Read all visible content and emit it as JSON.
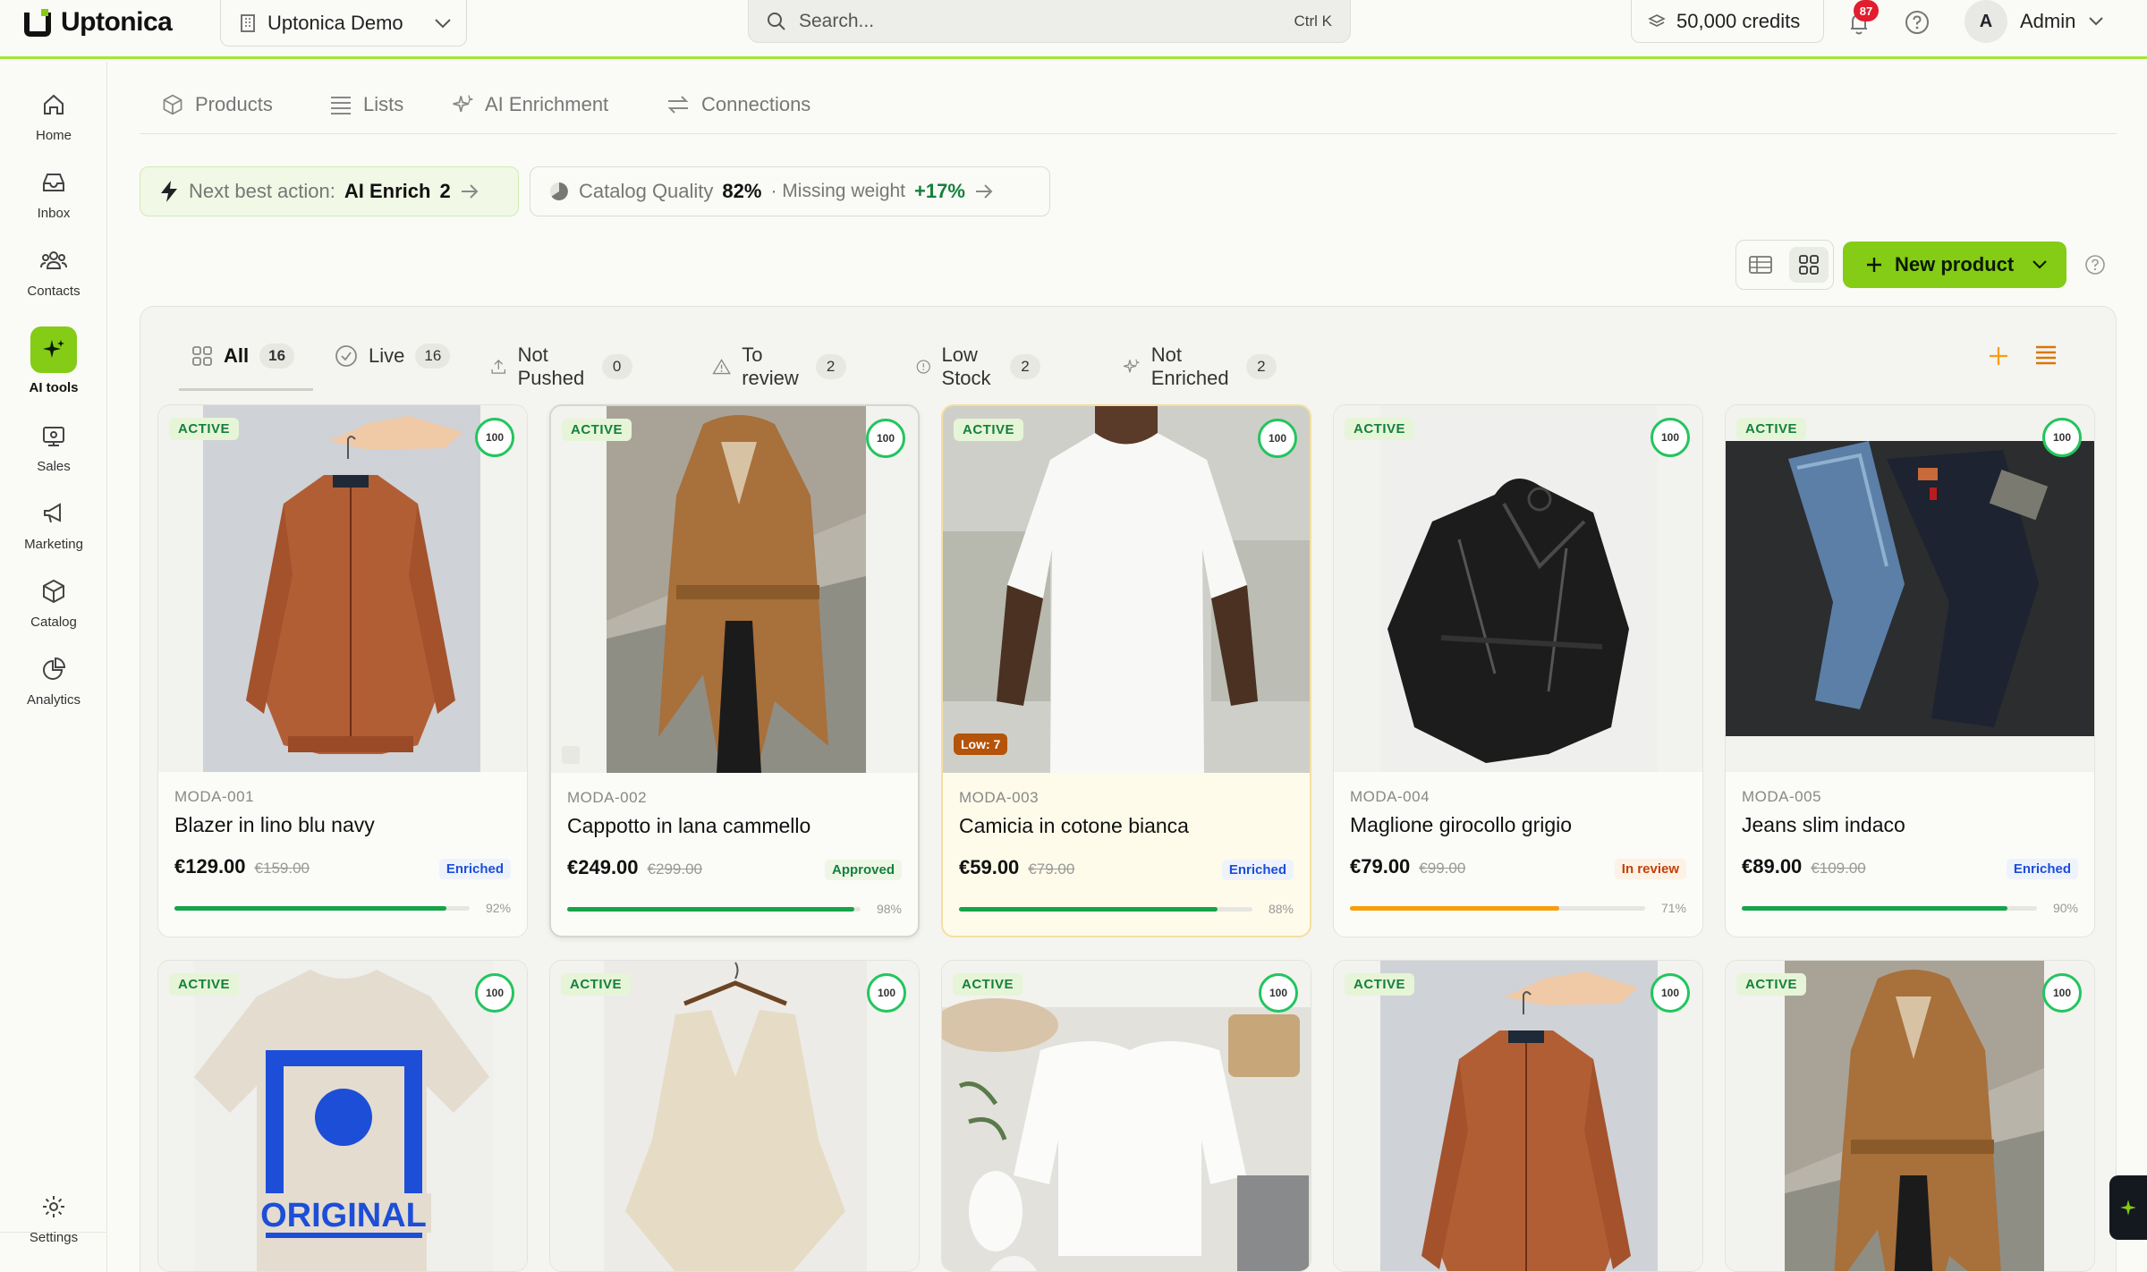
{
  "app": {
    "name": "Uptonica",
    "workspace": "Uptonica Demo",
    "search_placeholder": "Search...",
    "search_shortcut": "Ctrl K",
    "credits": "50,000 credits",
    "notifications_count": "87",
    "user_initial": "A",
    "user_name": "Admin",
    "accent_color": "#84cc16"
  },
  "sidebar": {
    "items": [
      {
        "label": "Home",
        "icon": "home-icon"
      },
      {
        "label": "Inbox",
        "icon": "inbox-icon"
      },
      {
        "label": "Contacts",
        "icon": "contacts-icon"
      },
      {
        "label": "AI tools",
        "icon": "sparkle-icon",
        "active": true
      },
      {
        "label": "Sales",
        "icon": "sales-icon"
      },
      {
        "label": "Marketing",
        "icon": "megaphone-icon"
      },
      {
        "label": "Catalog",
        "icon": "box-icon"
      },
      {
        "label": "Analytics",
        "icon": "pie-chart-icon"
      }
    ],
    "settings_label": "Settings"
  },
  "subnav": {
    "items": [
      "Products",
      "Lists",
      "AI Enrichment",
      "Connections"
    ]
  },
  "insights": {
    "next_best_action_label": "Next best action:",
    "next_best_action_value": "AI Enrich",
    "next_best_action_count": "2",
    "catalog_quality_label": "Catalog Quality",
    "catalog_quality_value": "82%",
    "missing_label": "· Missing weight",
    "missing_delta": "+17%"
  },
  "toolbar": {
    "new_product_label": "New product"
  },
  "tabs": [
    {
      "label": "All",
      "count": "16",
      "icon": "grid-icon"
    },
    {
      "label": "Live",
      "count": "16",
      "icon": "check-circle-icon"
    },
    {
      "label": "Not Pushed",
      "count": "0",
      "icon": "upload-icon"
    },
    {
      "label": "To review",
      "count": "2",
      "icon": "warning-icon"
    },
    {
      "label": "Low Stock",
      "count": "2",
      "icon": "alert-circle-icon"
    },
    {
      "label": "Not Enriched",
      "count": "2",
      "icon": "sparkle-icon"
    }
  ],
  "products": [
    {
      "badge": "ACTIVE",
      "score": "100",
      "sku": "MODA-001",
      "name": "Blazer in lino blu navy",
      "price": "€129.00",
      "old_price": "€159.00",
      "status": "Enriched",
      "status_kind": "enriched",
      "completeness": "92%",
      "completeness_value": 0.92,
      "bar_color": "#16a34a",
      "image": "bomber-jacket"
    },
    {
      "badge": "ACTIVE",
      "score": "100",
      "sku": "MODA-002",
      "name": "Cappotto in lana cammello",
      "price": "€249.00",
      "old_price": "€299.00",
      "status": "Approved",
      "status_kind": "approved",
      "completeness": "98%",
      "completeness_value": 0.98,
      "bar_color": "#16a34a",
      "image": "camel-coat"
    },
    {
      "badge": "ACTIVE",
      "score": "100",
      "sku": "MODA-003",
      "name": "Camicia in cotone bianca",
      "price": "€59.00",
      "old_price": "€79.00",
      "status": "Enriched",
      "status_kind": "enriched",
      "completeness": "88%",
      "completeness_value": 0.88,
      "bar_color": "#16a34a",
      "image": "white-tee",
      "low_stock": "Low: 7"
    },
    {
      "badge": "ACTIVE",
      "score": "100",
      "sku": "MODA-004",
      "name": "Maglione girocollo grigio",
      "price": "€79.00",
      "old_price": "€99.00",
      "status": "In review",
      "status_kind": "review",
      "completeness": "71%",
      "completeness_value": 0.71,
      "bar_color": "#f59e0b",
      "image": "leather-jacket"
    },
    {
      "badge": "ACTIVE",
      "score": "100",
      "sku": "MODA-005",
      "name": "Jeans slim indaco",
      "price": "€89.00",
      "old_price": "€109.00",
      "status": "Enriched",
      "status_kind": "enriched",
      "completeness": "90%",
      "completeness_value": 0.9,
      "bar_color": "#16a34a",
      "image": "jeans"
    },
    {
      "badge": "ACTIVE",
      "score": "100",
      "image": "graphic-tee"
    },
    {
      "badge": "ACTIVE",
      "score": "100",
      "image": "knit-poncho"
    },
    {
      "badge": "ACTIVE",
      "score": "100",
      "image": "white-sweatshirt"
    },
    {
      "badge": "ACTIVE",
      "score": "100",
      "image": "bomber-jacket"
    },
    {
      "badge": "ACTIVE",
      "score": "100",
      "image": "camel-coat"
    }
  ]
}
